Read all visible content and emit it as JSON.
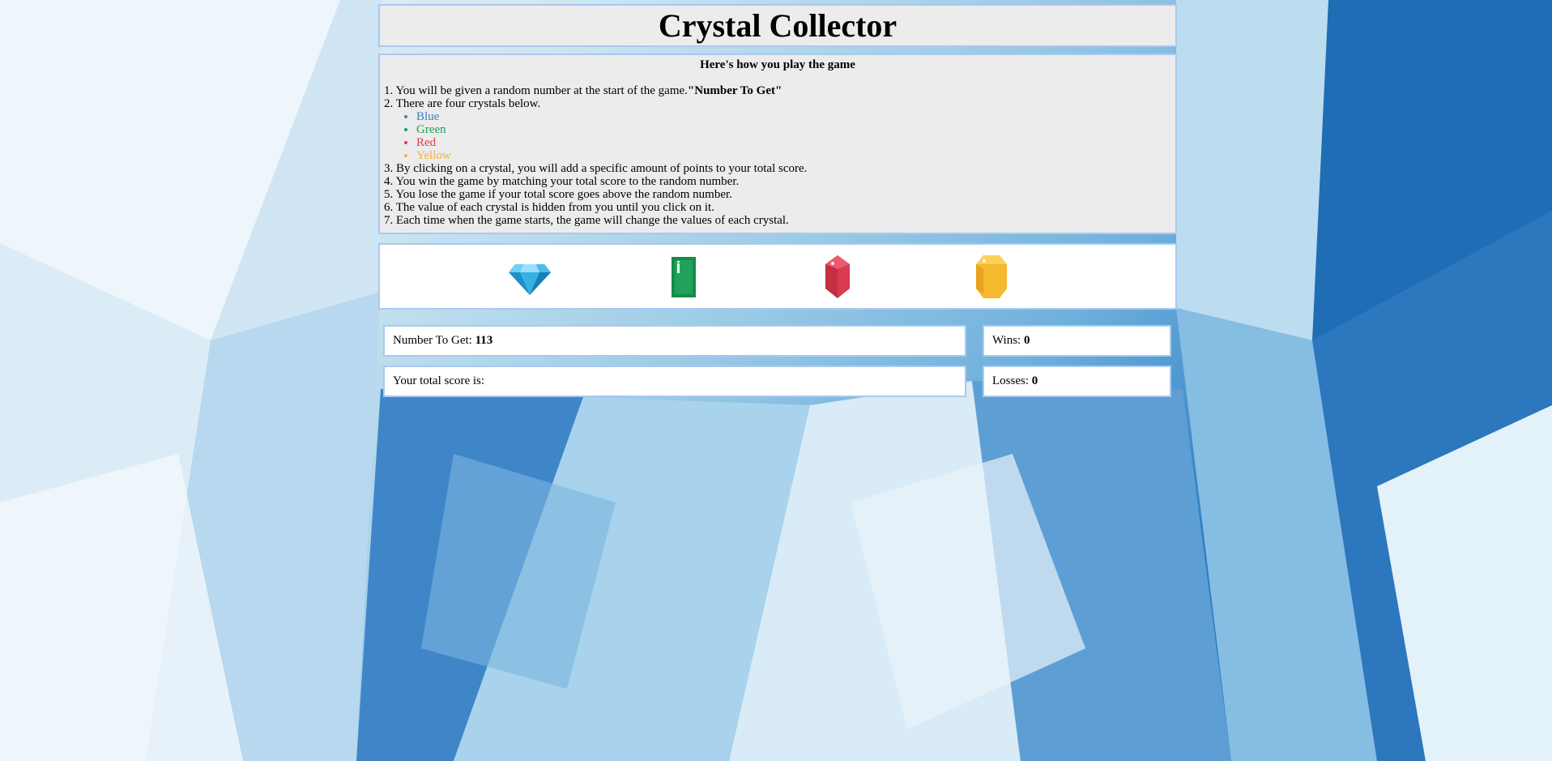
{
  "title": "Crystal Collector",
  "rules": {
    "heading": "Here's how you play the game",
    "line1_text": "1. You will be given a random number at the start of the game.",
    "line1_bold": "\"Number To Get\"",
    "line2": "2. There are four crystals below.",
    "crystals": [
      {
        "label": "Blue",
        "color": "#3d7fc4"
      },
      {
        "label": "Green",
        "color": "#1e9e5a"
      },
      {
        "label": "Red",
        "color": "#e03a4c"
      },
      {
        "label": "Yellow",
        "color": "#f2b33d"
      }
    ],
    "line3": "3. By clicking on a crystal, you will add a specific amount of points to your total score.",
    "line4": "4. You win the game by matching your total score to the random number.",
    "line5": "5. You lose the game if your total score goes above the random number.",
    "line6": "6. The value of each crystal is hidden from you until you click on it.",
    "line7": "7. Each time when the game starts, the game will change the values of each crystal."
  },
  "gems": [
    {
      "name": "blue-diamond-crystal-icon",
      "color": "#29a8df"
    },
    {
      "name": "green-emerald-crystal-icon",
      "color": "#1fa35b"
    },
    {
      "name": "red-ruby-crystal-icon",
      "color": "#d83a4f"
    },
    {
      "name": "yellow-topaz-crystal-icon",
      "color": "#f5b82e"
    }
  ],
  "stats": {
    "number_label": "Number To Get: ",
    "number_value": "113",
    "score_label": "Your total score is: ",
    "score_value": "",
    "wins_label": "Wins: ",
    "wins_value": "0",
    "losses_label": "Losses: ",
    "losses_value": "0"
  }
}
